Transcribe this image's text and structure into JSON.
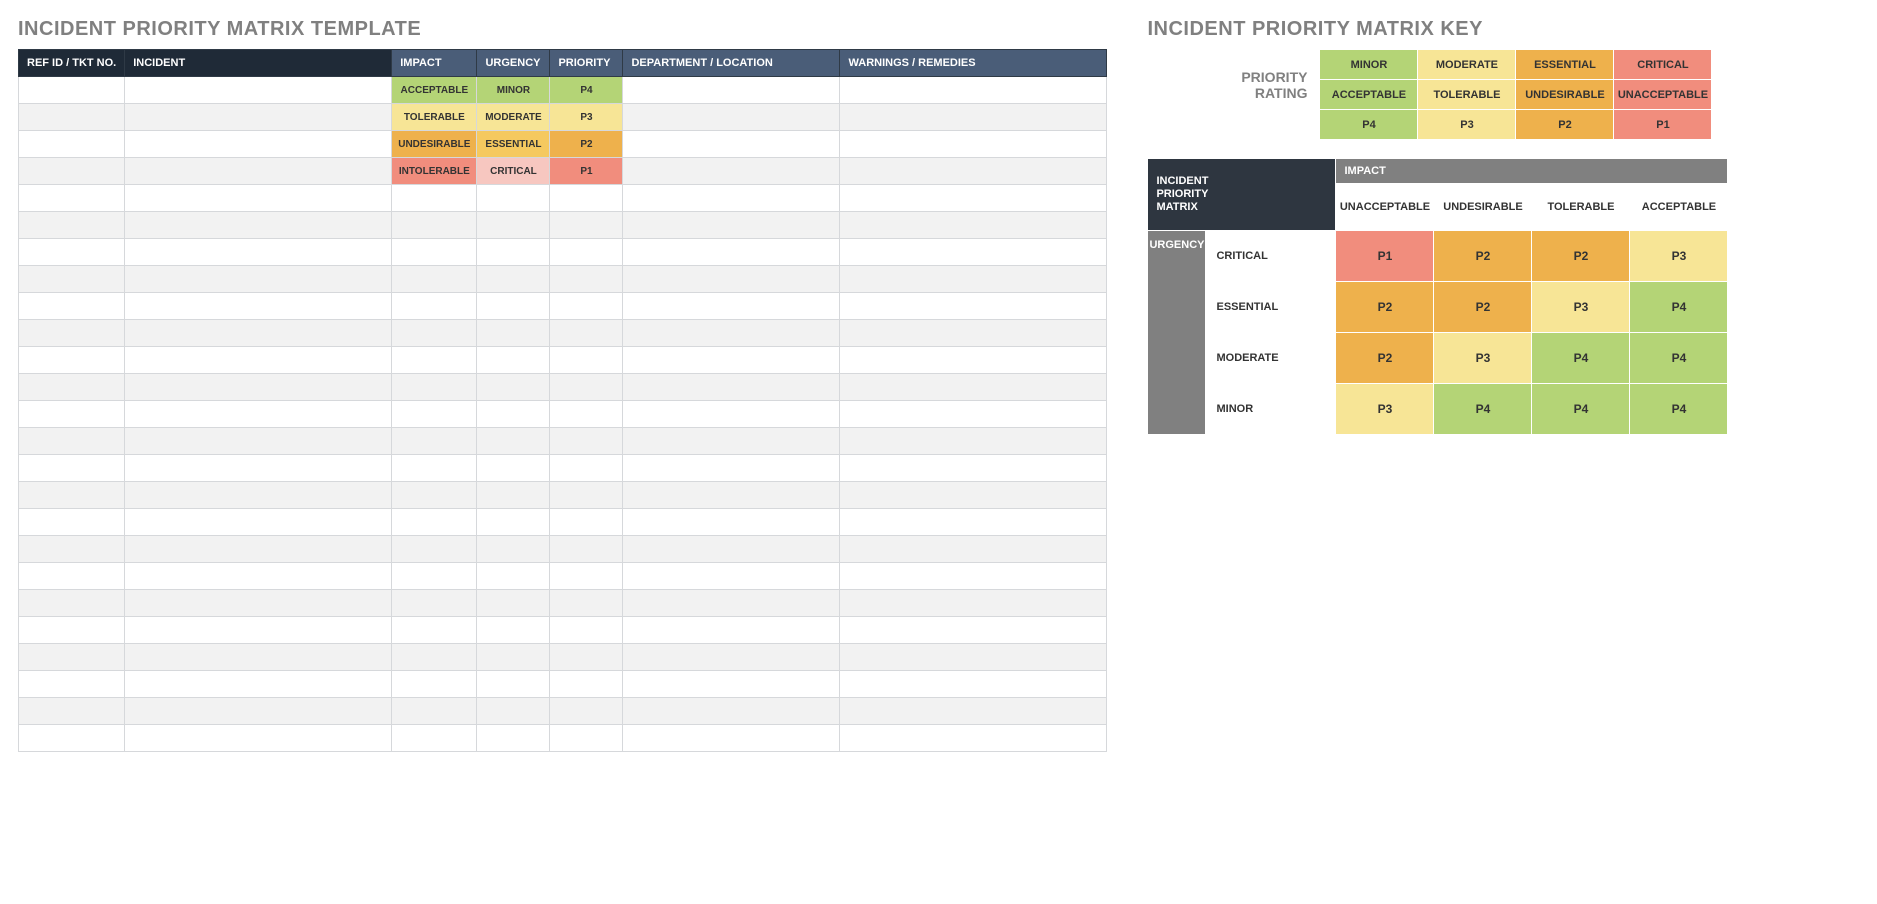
{
  "titles": {
    "template": "INCIDENT PRIORITY MATRIX TEMPLATE",
    "key": "INCIDENT PRIORITY MATRIX KEY"
  },
  "colors": {
    "green": "#b4d476",
    "lightyellow": "#f7e596",
    "yellow": "#f5c95f",
    "orange": "#eeb14c",
    "lightred_urg": "#f7c7c0",
    "red": "#f18d7d",
    "gray": "#808080",
    "dark": "#2e3640"
  },
  "template_table": {
    "headers": {
      "ref": "REF ID / TKT NO.",
      "incident": "INCIDENT",
      "impact": "IMPACT",
      "urgency": "URGENCY",
      "priority": "PRIORITY",
      "dept": "DEPARTMENT / LOCATION",
      "warn": "WARNINGS / REMEDIES"
    },
    "col_widths": {
      "ref": 80,
      "incident": 250,
      "impact": 64,
      "urgency": 56,
      "priority": 56,
      "dept": 200,
      "warn": 250
    },
    "rows": [
      {
        "impact": "ACCEPTABLE",
        "urgency": "MINOR",
        "priority": "P4",
        "impact_bg": "green",
        "urgency_bg": "green",
        "priority_bg": "green"
      },
      {
        "impact": "TOLERABLE",
        "urgency": "MODERATE",
        "priority": "P3",
        "impact_bg": "lightyellow",
        "urgency_bg": "lightyellow",
        "priority_bg": "lightyellow"
      },
      {
        "impact": "UNDESIRABLE",
        "urgency": "ESSENTIAL",
        "priority": "P2",
        "impact_bg": "orange",
        "urgency_bg": "yellow",
        "priority_bg": "orange"
      },
      {
        "impact": "INTOLERABLE",
        "urgency": "CRITICAL",
        "priority": "P1",
        "impact_bg": "red",
        "urgency_bg": "lightred_urg",
        "priority_bg": "red"
      }
    ],
    "blank_rows": 21
  },
  "priority_rating": {
    "label1": "PRIORITY",
    "label2": "RATING",
    "cols": [
      {
        "sev": "MINOR",
        "imp": "ACCEPTABLE",
        "p": "P4",
        "bg": "green"
      },
      {
        "sev": "MODERATE",
        "imp": "TOLERABLE",
        "p": "P3",
        "bg": "lightyellow"
      },
      {
        "sev": "ESSENTIAL",
        "imp": "UNDESIRABLE",
        "p": "P2",
        "bg": "orange"
      },
      {
        "sev": "CRITICAL",
        "imp": "UNACCEPTABLE",
        "p": "P1",
        "bg": "red"
      }
    ]
  },
  "matrix": {
    "corner_l1": "INCIDENT",
    "corner_l2": "PRIORITY",
    "corner_l3": "MATRIX",
    "impact_label": "IMPACT",
    "urgency_label": "URGENCY",
    "impact_cols": [
      "UNACCEPTABLE",
      "UNDESIRABLE",
      "TOLERABLE",
      "ACCEPTABLE"
    ],
    "urgency_rows": [
      "CRITICAL",
      "ESSENTIAL",
      "MODERATE",
      "MINOR"
    ],
    "cells": [
      [
        {
          "v": "P1",
          "bg": "red"
        },
        {
          "v": "P2",
          "bg": "orange"
        },
        {
          "v": "P2",
          "bg": "orange"
        },
        {
          "v": "P3",
          "bg": "lightyellow"
        }
      ],
      [
        {
          "v": "P2",
          "bg": "orange"
        },
        {
          "v": "P2",
          "bg": "orange"
        },
        {
          "v": "P3",
          "bg": "lightyellow"
        },
        {
          "v": "P4",
          "bg": "green"
        }
      ],
      [
        {
          "v": "P2",
          "bg": "orange"
        },
        {
          "v": "P3",
          "bg": "lightyellow"
        },
        {
          "v": "P4",
          "bg": "green"
        },
        {
          "v": "P4",
          "bg": "green"
        }
      ],
      [
        {
          "v": "P3",
          "bg": "lightyellow"
        },
        {
          "v": "P4",
          "bg": "green"
        },
        {
          "v": "P4",
          "bg": "green"
        },
        {
          "v": "P4",
          "bg": "green"
        }
      ]
    ]
  }
}
